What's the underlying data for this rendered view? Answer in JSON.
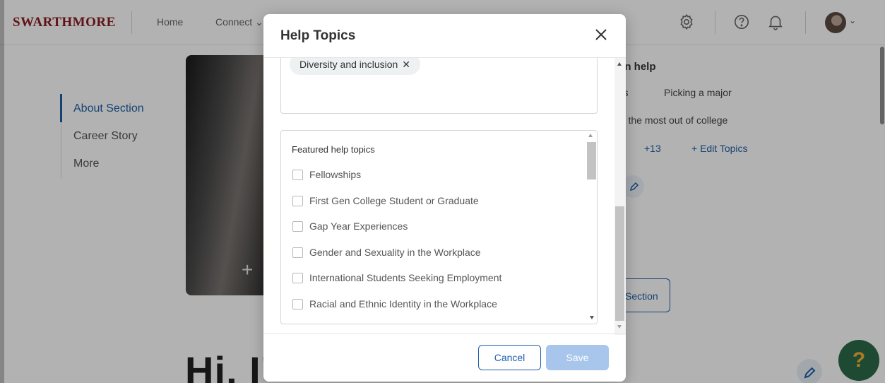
{
  "header": {
    "logo": "SWARTHMORE",
    "nav": {
      "home": "Home",
      "connect": "Connect",
      "connect_caret": "⌄"
    },
    "icons": [
      "gear-icon",
      "help-circle-icon",
      "bell-icon"
    ],
    "avatar_caret": "⌄"
  },
  "sidebar": {
    "items": [
      {
        "label": "About Section",
        "active": true
      },
      {
        "label": "Career Story",
        "active": false
      },
      {
        "label": "More",
        "active": false
      }
    ]
  },
  "photo": {
    "add_symbol": "+"
  },
  "right_panel": {
    "title_partial": "an help",
    "chip_partial": "ers",
    "chip_picking": "Picking a major",
    "chip_most_partial": "ng the most out of college",
    "more_count": "+13",
    "edit_topics": "+ Edit Topics",
    "section_button_partial": "Section"
  },
  "greeting_partial": "Hi, I'",
  "help_fab": {
    "symbol": "?"
  },
  "modal": {
    "title": "Help Topics",
    "close_symbol": "✕",
    "selected_chips": [
      {
        "label": "Diversity and inclusion",
        "remove_symbol": "✕"
      }
    ],
    "featured_heading": "Featured help topics",
    "featured_topics": [
      "Fellowships",
      "First Gen College Student or Graduate",
      "Gap Year Experiences",
      "Gender and Sexuality in the Workplace",
      "International Students Seeking Employment",
      "Racial and Ethnic Identity in the Workplace"
    ],
    "cancel_label": "Cancel",
    "save_label": "Save"
  },
  "colors": {
    "brand": "#8a1c22",
    "accent": "#1f5fa8",
    "save_disabled": "#a8c6ec",
    "help_fab": "#2c6b49"
  }
}
